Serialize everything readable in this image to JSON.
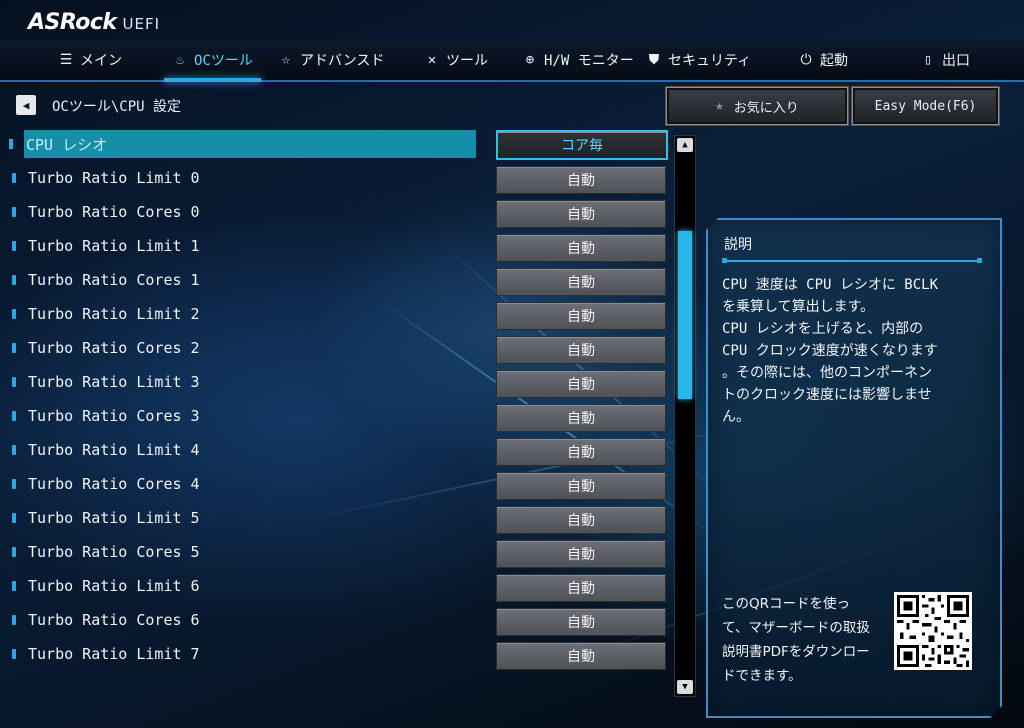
{
  "header": {
    "brand": "ASRock",
    "brand_suffix": "UEFI"
  },
  "nav": {
    "items": [
      {
        "label": "メイン",
        "icon": "list-icon",
        "active": false
      },
      {
        "label": "OCツール",
        "icon": "flame-icon",
        "active": true
      },
      {
        "label": "アドバンスド",
        "icon": "star-icon",
        "active": false
      },
      {
        "label": "ツール",
        "icon": "tools-icon",
        "active": false
      },
      {
        "label": "H/W モニター",
        "icon": "crosshair-icon",
        "active": false
      },
      {
        "label": "セキュリティ",
        "icon": "shield-icon",
        "active": false
      },
      {
        "label": "起動",
        "icon": "power-icon",
        "active": false
      },
      {
        "label": "出口",
        "icon": "exit-icon",
        "active": false
      }
    ]
  },
  "breadcrumb": "OCツール\\CPU 設定",
  "buttons": {
    "favorites": "お気に入り",
    "easy_mode": "Easy Mode(F6)"
  },
  "settings": [
    {
      "label": "CPU レシオ",
      "value": "コア毎",
      "selected": true
    },
    {
      "label": "Turbo Ratio Limit 0",
      "value": "自動"
    },
    {
      "label": "Turbo Ratio Cores 0",
      "value": "自動"
    },
    {
      "label": "Turbo Ratio Limit 1",
      "value": "自動"
    },
    {
      "label": "Turbo Ratio Cores 1",
      "value": "自動"
    },
    {
      "label": "Turbo Ratio Limit 2",
      "value": "自動"
    },
    {
      "label": "Turbo Ratio Cores 2",
      "value": "自動"
    },
    {
      "label": "Turbo Ratio Limit 3",
      "value": "自動"
    },
    {
      "label": "Turbo Ratio Cores 3",
      "value": "自動"
    },
    {
      "label": "Turbo Ratio Limit 4",
      "value": "自動"
    },
    {
      "label": "Turbo Ratio Cores 4",
      "value": "自動"
    },
    {
      "label": "Turbo Ratio Limit 5",
      "value": "自動"
    },
    {
      "label": "Turbo Ratio Cores 5",
      "value": "自動"
    },
    {
      "label": "Turbo Ratio Limit 6",
      "value": "自動"
    },
    {
      "label": "Turbo Ratio Cores 6",
      "value": "自動"
    },
    {
      "label": "Turbo Ratio Limit 7",
      "value": "自動"
    }
  ],
  "description": {
    "title": "説明",
    "lines": [
      "CPU 速度は CPU レシオに BCLK",
      "を乗算して算出します。",
      "CPU レシオを上げると、内部の",
      "CPU クロック速度が速くなります",
      "。その際には、他のコンポーネン",
      "トのクロック速度には影響しませ",
      "ん。"
    ],
    "qr_text": "このQRコードを使って、マザーボードの取扱説明書PDFをダウンロードできます。"
  },
  "colors": {
    "accent": "#2aa8e8",
    "selected_row": "#178ea8",
    "value_button": "#5e6166"
  }
}
